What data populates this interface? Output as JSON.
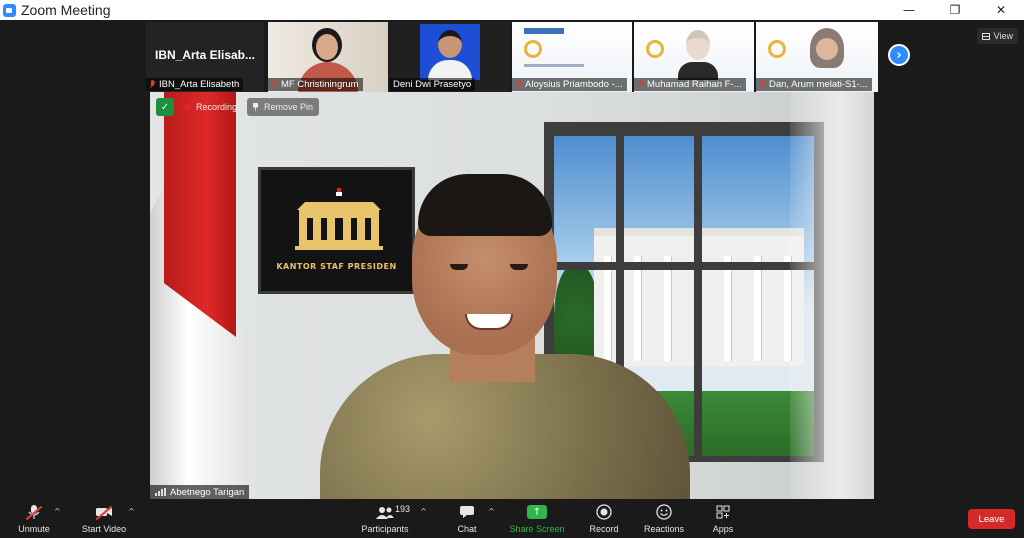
{
  "window": {
    "title": "Zoom Meeting",
    "controls": {
      "minimize": "—",
      "restore": "❐",
      "close": "✕"
    }
  },
  "strip": {
    "view_label": "View",
    "tiles": [
      {
        "name": "IBN_Arta Elisabeth",
        "big_name": "IBN_Arta  Elisab...",
        "muted": true
      },
      {
        "name": "MF Christiningrum",
        "muted": true
      },
      {
        "name": "Deni Dwi Prasetyo",
        "muted": false
      },
      {
        "name": "Aloysius Priambodo -...",
        "muted": true
      },
      {
        "name": "Muhamad Raihan F-...",
        "muted": true
      },
      {
        "name": "Dan, Arum melati-S1-...",
        "muted": true
      }
    ]
  },
  "main": {
    "recording_label": "Recording",
    "remove_pin_label": "Remove Pin",
    "speaker_name": "Abetnego Tarigan",
    "frame_text": "KANTOR STAF PRESIDEN"
  },
  "toolbar": {
    "unmute": "Unmute",
    "start_video": "Start Video",
    "participants": "Participants",
    "participants_count": "193",
    "chat": "Chat",
    "share_screen": "Share Screen",
    "record": "Record",
    "reactions": "Reactions",
    "apps": "Apps",
    "leave": "Leave"
  },
  "colors": {
    "accent": "#2d8cff",
    "share_green": "#2eb84b",
    "leave_red": "#d42a2a",
    "recording_red": "#e02828"
  }
}
